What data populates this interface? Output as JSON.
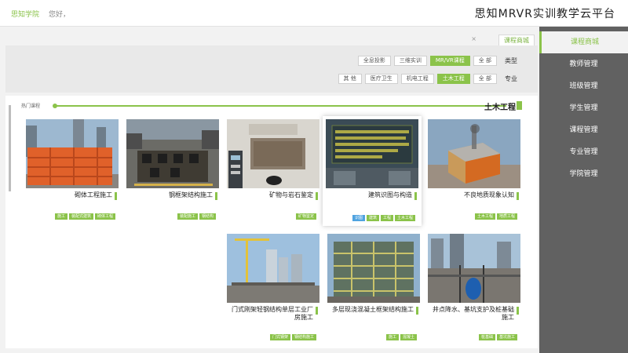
{
  "header": {
    "title": "思知MRVR实训教学云平台",
    "greeting": "您好，",
    "username": "思知学院"
  },
  "sidebar": {
    "items": [
      {
        "label": "课程商城",
        "active": true
      },
      {
        "label": "教师管理"
      },
      {
        "label": "班级管理"
      },
      {
        "label": "学生管理"
      },
      {
        "label": "课程管理"
      },
      {
        "label": "专业管理"
      },
      {
        "label": "学院管理"
      }
    ]
  },
  "tabbar": {
    "tab_label": "课程商城",
    "close": "×"
  },
  "filters": {
    "type_label": "类型",
    "type_options": [
      {
        "label": "全 部"
      },
      {
        "label": "MR/VR课程",
        "active": true
      },
      {
        "label": "三维实训"
      },
      {
        "label": "全息投影"
      }
    ],
    "major_label": "专业",
    "major_options": [
      {
        "label": "全 部"
      },
      {
        "label": "土木工程",
        "active": true
      },
      {
        "label": "机电工程"
      },
      {
        "label": "医疗卫生"
      },
      {
        "label": "其 他"
      }
    ]
  },
  "section": {
    "title": "土木工程",
    "left_label": "热门课程"
  },
  "courses": [
    {
      "title": "不良地质现象认知",
      "tags": [
        "地质工程",
        "土木工程"
      ]
    },
    {
      "title": "建筑识图与构造",
      "tags": [
        "土木工程",
        "工程",
        "建筑",
        "识图"
      ],
      "highlighted": true
    },
    {
      "title": "矿物与岩石鉴定",
      "tags": [
        "矿物鉴定"
      ]
    },
    {
      "title": "钢框架结构施工",
      "tags": [
        "钢结构",
        "装配施工"
      ]
    },
    {
      "title": "砌体工程施工",
      "tags": [
        "砌体工程",
        "装配式建筑",
        "施工"
      ]
    },
    {
      "title": "井点降水、基坑支护及桩基础施工",
      "tags": [
        "基坑施工",
        "桩基础"
      ]
    },
    {
      "title": "多层现浇混凝土框架结构施工",
      "tags": [
        "混凝土",
        "施工"
      ]
    },
    {
      "title": "门式刚架轻钢结构单层工业厂房施工",
      "tags": [
        "钢结构施工",
        "门式钢架"
      ]
    }
  ],
  "colors": {
    "accent": "#8bc34a",
    "sidebar": "#616161",
    "tag_blue": "#4fa3e0"
  }
}
